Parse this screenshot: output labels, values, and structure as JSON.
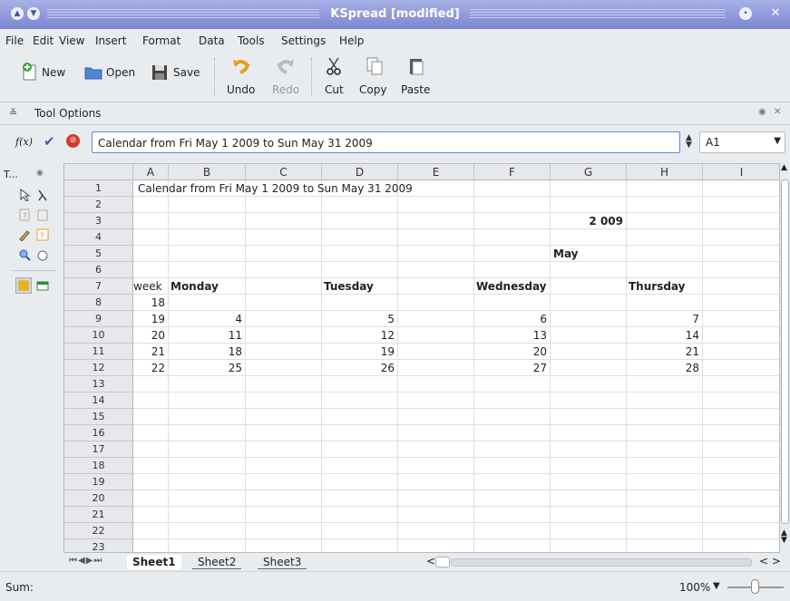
{
  "window": {
    "title": "KSpread [modified]"
  },
  "menu": [
    "File",
    "Edit",
    "View",
    "Insert",
    "Format",
    "Data",
    "Tools",
    "Settings",
    "Help"
  ],
  "toolbar": {
    "new": "New",
    "open": "Open",
    "save": "Save",
    "undo": "Undo",
    "redo": "Redo",
    "cut": "Cut",
    "copy": "Copy",
    "paste": "Paste"
  },
  "tool_options": {
    "label": "Tool Options"
  },
  "formula_bar": {
    "fx": "f(x)",
    "value": "Calendar from Fri May 1 2009 to Sun May 31 2009",
    "cell_ref": "A1"
  },
  "tool_panel": {
    "title": "T..."
  },
  "sheet": {
    "columns": [
      "A",
      "B",
      "C",
      "D",
      "E",
      "F",
      "G",
      "H",
      "I"
    ],
    "rows": [
      "1",
      "2",
      "3",
      "4",
      "5",
      "6",
      "7",
      "8",
      "9",
      "10",
      "11",
      "12",
      "13",
      "14",
      "15",
      "16",
      "17",
      "18",
      "19",
      "20",
      "21",
      "22",
      "23"
    ],
    "cells": {
      "a1": "Calendar from Fri May 1 2009 to Sun May 31 2009",
      "g3": "2 009",
      "g5": "May",
      "a7": "week",
      "b7": "Monday",
      "d7": "Tuesday",
      "f7": "Wednesday",
      "h7": "Thursday",
      "a8": "18",
      "a9": "19",
      "b9": "4",
      "d9": "5",
      "f9": "6",
      "h9": "7",
      "a10": "20",
      "b10": "11",
      "d10": "12",
      "f10": "13",
      "h10": "14",
      "a11": "21",
      "b11": "18",
      "d11": "19",
      "f11": "20",
      "h11": "21",
      "a12": "22",
      "b12": "25",
      "d12": "26",
      "f12": "27",
      "h12": "28"
    }
  },
  "tabs": [
    "Sheet1",
    "Sheet2",
    "Sheet3"
  ],
  "status": {
    "sum": "Sum:",
    "zoom": "100%"
  },
  "colors": {
    "titlebar": "#8a93d8",
    "accent": "#5b8bd9"
  }
}
